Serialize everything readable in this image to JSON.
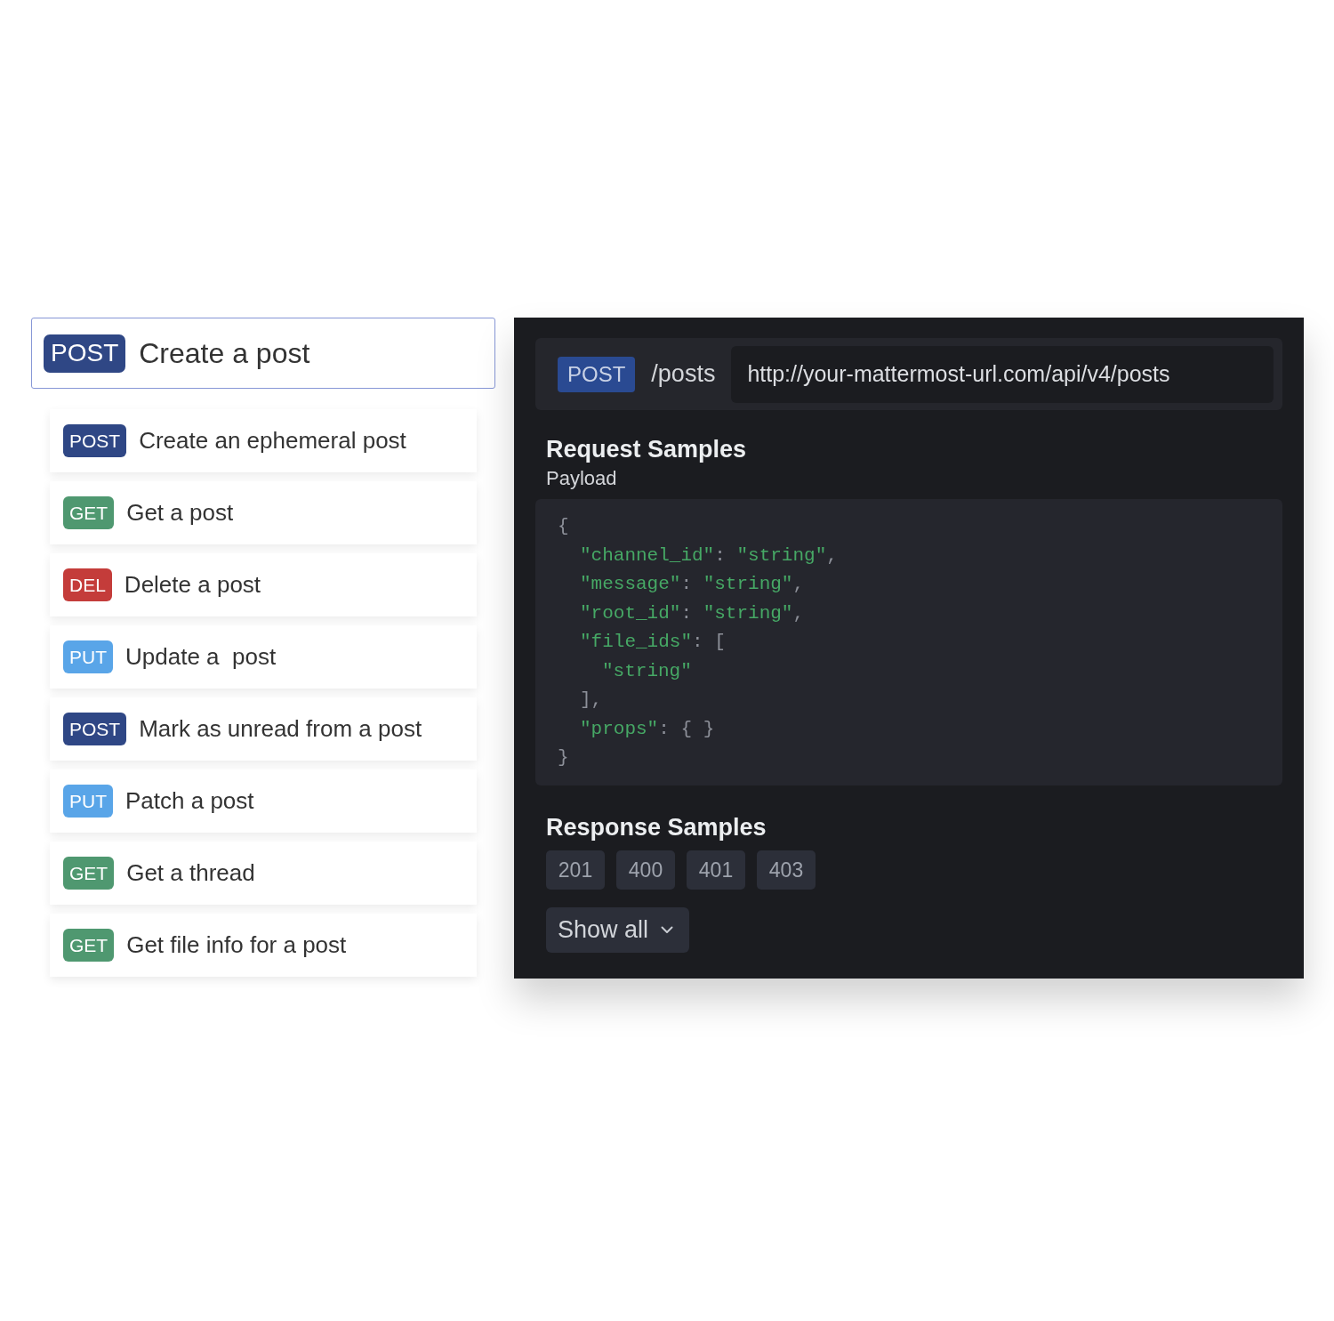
{
  "sidebar": {
    "items": [
      {
        "method": "POST",
        "color": "#2f4785",
        "title": "Create a post",
        "selected": true
      },
      {
        "method": "POST",
        "color": "#2f4785",
        "title": "Create an ephemeral post",
        "selected": false
      },
      {
        "method": "GET",
        "color": "#4f9870",
        "title": "Get a post",
        "selected": false
      },
      {
        "method": "DEL",
        "color": "#c43c3a",
        "title": "Delete a post",
        "selected": false
      },
      {
        "method": "PUT",
        "color": "#59a5e8",
        "title": "Update a  post",
        "selected": false
      },
      {
        "method": "POST",
        "color": "#2f4785",
        "title": "Mark as unread from a post",
        "selected": false
      },
      {
        "method": "PUT",
        "color": "#59a5e8",
        "title": "Patch a post",
        "selected": false
      },
      {
        "method": "GET",
        "color": "#4f9870",
        "title": "Get a thread",
        "selected": false
      },
      {
        "method": "GET",
        "color": "#4f9870",
        "title": "Get file info for a post",
        "selected": false
      }
    ]
  },
  "endpoint": {
    "method": "POST",
    "color": "#2a4a92",
    "path": "/posts",
    "url": "http://your-mattermost-url.com/api/v4/posts"
  },
  "request_samples": {
    "title": "Request Samples",
    "subtitle": "Payload",
    "code": [
      {
        "tokens": [
          {
            "kind": "punct",
            "text": "{"
          }
        ],
        "children": [
          {
            "tokens": [
              {
                "kind": "key",
                "text": "\"channel_id\""
              },
              {
                "kind": "punct",
                "text": ": "
              },
              {
                "kind": "string",
                "text": "\"string\""
              },
              {
                "kind": "punct",
                "text": ","
              }
            ]
          },
          {
            "tokens": [
              {
                "kind": "key",
                "text": "\"message\""
              },
              {
                "kind": "punct",
                "text": ": "
              },
              {
                "kind": "string",
                "text": "\"string\""
              },
              {
                "kind": "punct",
                "text": ","
              }
            ]
          },
          {
            "tokens": [
              {
                "kind": "key",
                "text": "\"root_id\""
              },
              {
                "kind": "punct",
                "text": ": "
              },
              {
                "kind": "string",
                "text": "\"string\""
              },
              {
                "kind": "punct",
                "text": ","
              }
            ]
          },
          {
            "tokens": [
              {
                "kind": "key",
                "text": "\"file_ids\""
              },
              {
                "kind": "punct",
                "text": ": ["
              }
            ],
            "children": [
              {
                "tokens": [
                  {
                    "kind": "string",
                    "text": "\"string\""
                  }
                ]
              }
            ]
          },
          {
            "tokens": [
              {
                "kind": "punct",
                "text": "],"
              }
            ]
          },
          {
            "tokens": [
              {
                "kind": "key",
                "text": "\"props\""
              },
              {
                "kind": "punct",
                "text": ": { }"
              }
            ]
          }
        ]
      },
      {
        "tokens": [
          {
            "kind": "punct",
            "text": "}"
          }
        ]
      }
    ]
  },
  "response_samples": {
    "title": "Response Samples",
    "codes": [
      {
        "label": "201",
        "selected": false
      },
      {
        "label": "400",
        "selected": false
      },
      {
        "label": "401",
        "selected": false
      },
      {
        "label": "403",
        "selected": false
      }
    ],
    "show_all": {
      "label": "Show all",
      "expanded": false
    }
  }
}
